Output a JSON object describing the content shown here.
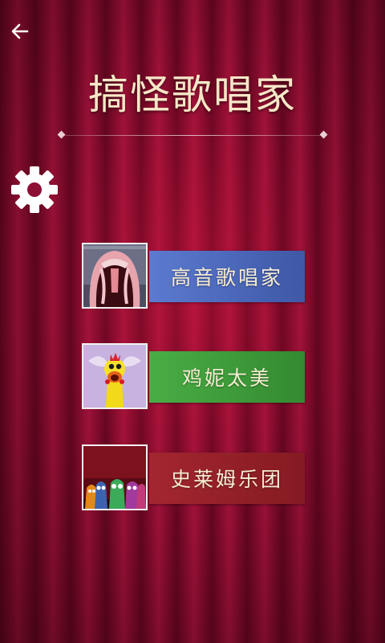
{
  "header": {
    "back_icon": "back-arrow-icon",
    "title": "搞怪歌唱家",
    "settings_icon": "gear-icon"
  },
  "menu": {
    "items": [
      {
        "label": "高音歌唱家",
        "color": "#4b67b8",
        "thumbnail": "mouth-creature-thumbnail"
      },
      {
        "label": "鸡妮太美",
        "color": "#3f9a3a",
        "thumbnail": "rubber-chicken-thumbnail"
      },
      {
        "label": "史莱姆乐团",
        "color": "#952026",
        "thumbnail": "slime-band-thumbnail"
      }
    ]
  }
}
